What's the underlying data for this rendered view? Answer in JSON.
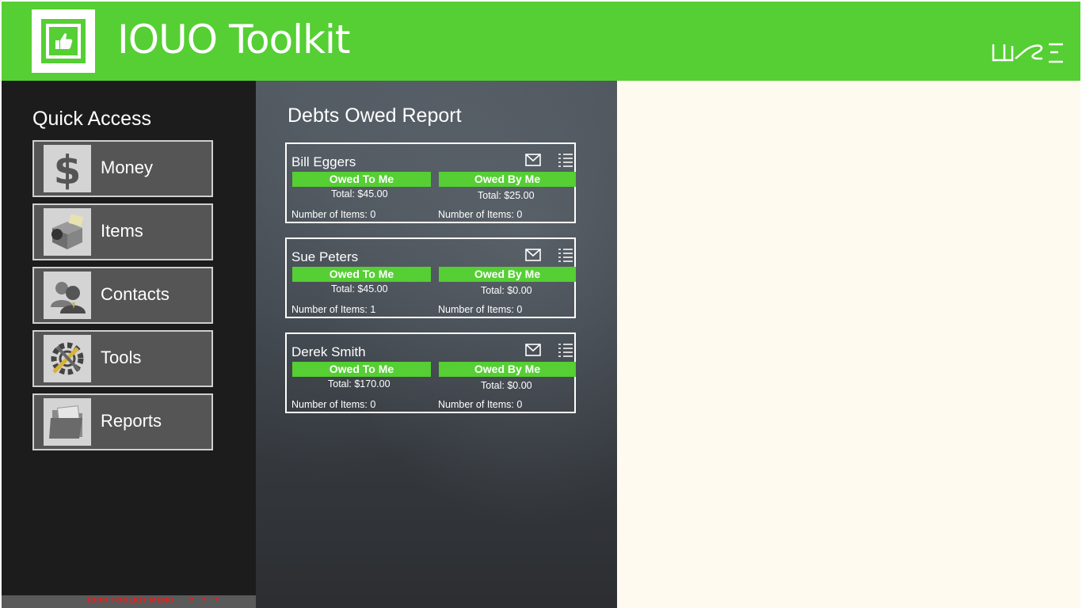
{
  "app": {
    "title": "IOUO Toolkit"
  },
  "colors": {
    "accent": "#55cf33",
    "sidebar": "#1c1c1c",
    "panel": "#fefaef",
    "error_text": "#e02222"
  },
  "sidebar": {
    "title": "Quick Access",
    "items": [
      {
        "label": "Money",
        "icon": "dollar-icon"
      },
      {
        "label": "Items",
        "icon": "box-icon"
      },
      {
        "label": "Contacts",
        "icon": "contacts-icon"
      },
      {
        "label": "Tools",
        "icon": "tools-icon"
      },
      {
        "label": "Reports",
        "icon": "folder-icon"
      }
    ]
  },
  "bottom_bar": {
    "text": "IOUO TOOLKIT MENU",
    "dots": "• • •"
  },
  "report": {
    "title": "Debts Owed Report",
    "owed_to_label": "Owed To Me",
    "owed_by_label": "Owed By Me",
    "cards": [
      {
        "name": "Bill Eggers",
        "owed_to_total": "Total: $45.00",
        "owed_by_total": "Total: $25.00",
        "owed_to_count": "Number of Items: 0",
        "owed_by_count": "Number of Items: 0"
      },
      {
        "name": "Sue Peters",
        "owed_to_total": "Total: $45.00",
        "owed_by_total": "Total: $0.00",
        "owed_to_count": "Number of Items: 1",
        "owed_by_count": "Number of Items: 0"
      },
      {
        "name": "Derek Smith",
        "owed_to_total": "Total: $170.00",
        "owed_by_total": "Total: $0.00",
        "owed_to_count": "Number of Items: 0",
        "owed_by_count": "Number of Items: 0"
      }
    ]
  }
}
